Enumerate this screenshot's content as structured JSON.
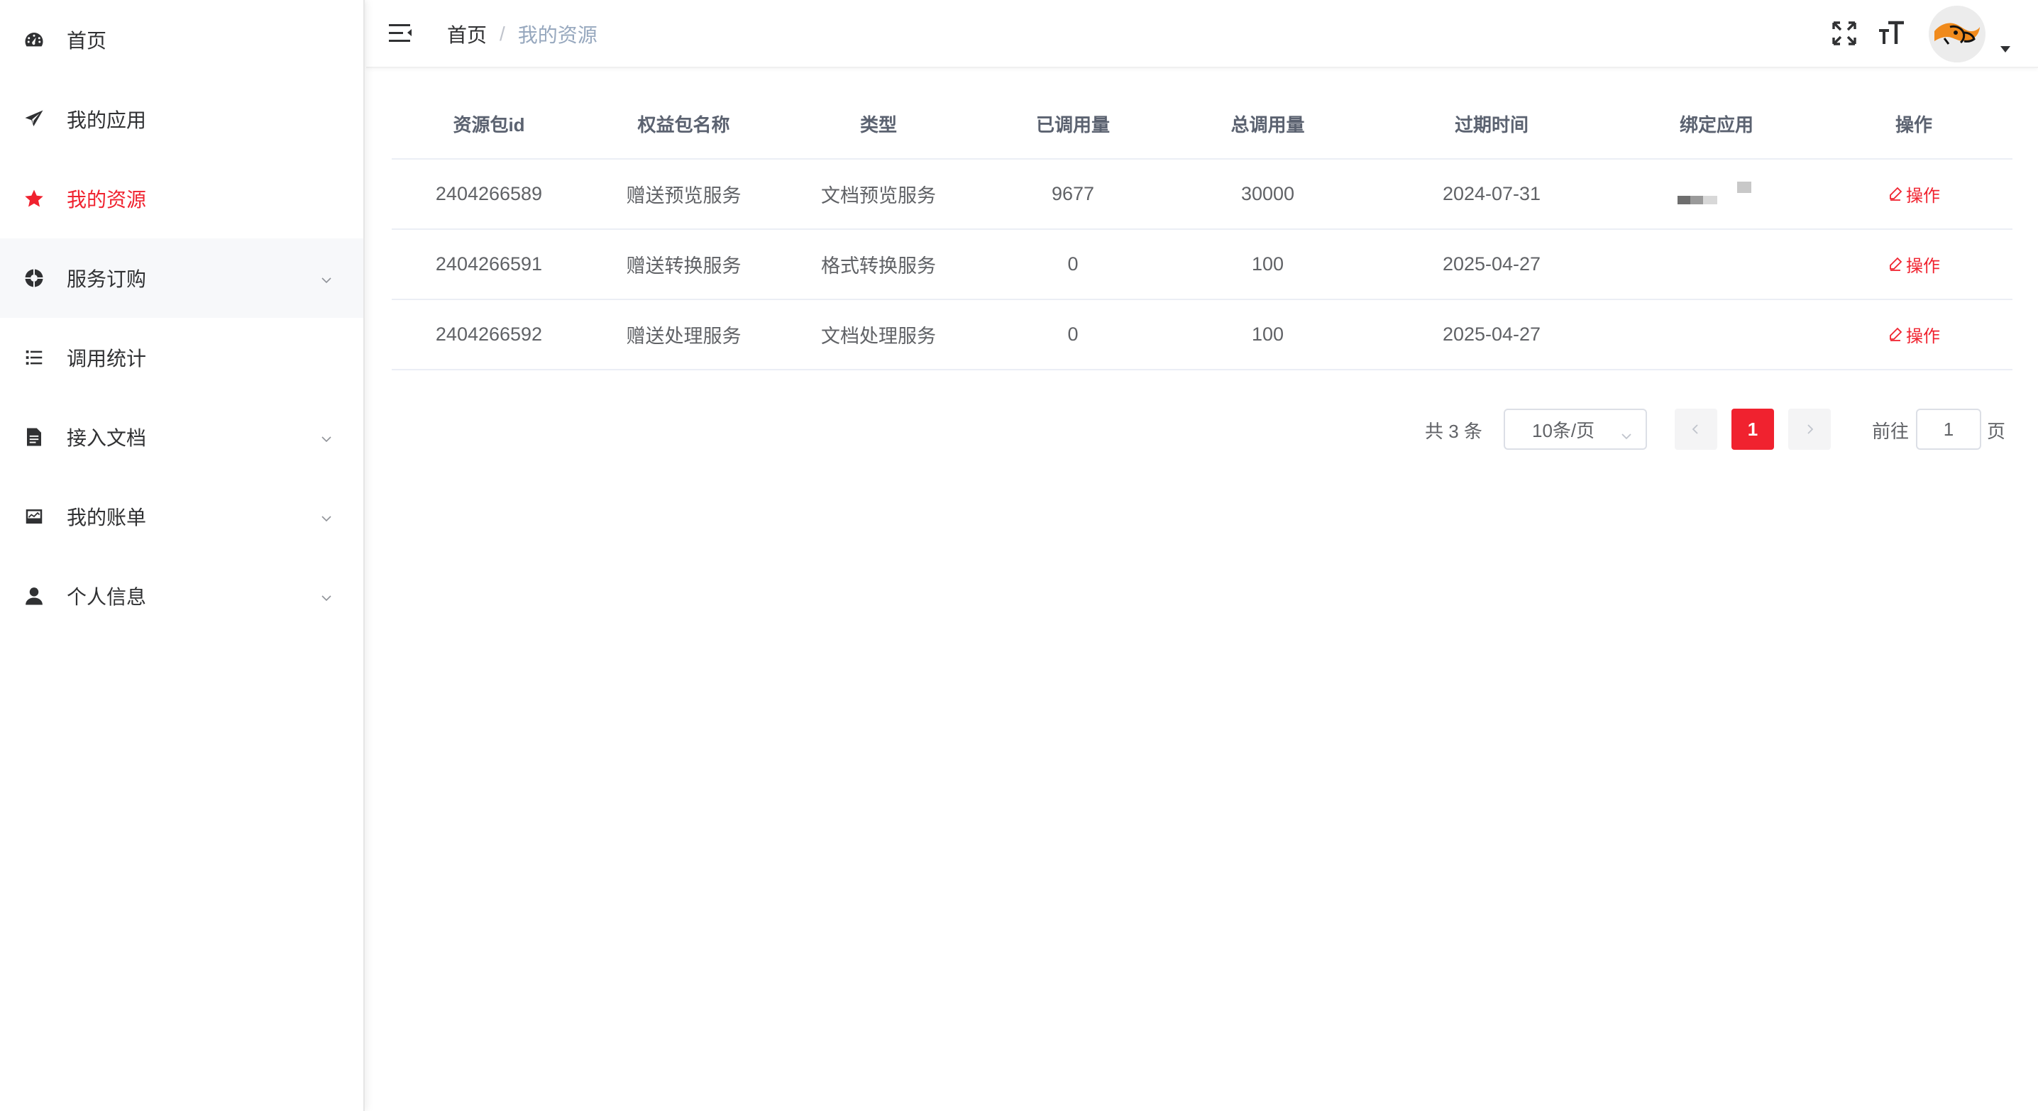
{
  "sidebar": {
    "items": [
      {
        "label": "首页",
        "icon": "dashboard-icon"
      },
      {
        "label": "我的应用",
        "icon": "paper-plane-icon"
      },
      {
        "label": "我的资源",
        "icon": "star-icon",
        "active": true
      },
      {
        "label": "服务订购",
        "icon": "aperture-icon",
        "expandable": true
      },
      {
        "label": "调用统计",
        "icon": "list-icon"
      },
      {
        "label": "接入文档",
        "icon": "document-icon",
        "expandable": true
      },
      {
        "label": "我的账单",
        "icon": "bill-icon",
        "expandable": true
      },
      {
        "label": "个人信息",
        "icon": "user-icon",
        "expandable": true
      }
    ]
  },
  "header": {
    "breadcrumb_home": "首页",
    "breadcrumb_separator": "/",
    "breadcrumb_current": "我的资源",
    "icons": [
      "hamburger-icon",
      "fullscreen-icon",
      "font-size-icon",
      "avatar",
      "caret-down-icon"
    ]
  },
  "table": {
    "columns": [
      "资源包id",
      "权益包名称",
      "类型",
      "已调用量",
      "总调用量",
      "过期时间",
      "绑定应用",
      "操作"
    ],
    "rows": [
      {
        "id": "2404266589",
        "name": "赠送预览服务",
        "type": "文档预览服务",
        "used": "9677",
        "total": "30000",
        "expire": "2024-07-31",
        "app": "",
        "action": "操作"
      },
      {
        "id": "2404266591",
        "name": "赠送转换服务",
        "type": "格式转换服务",
        "used": "0",
        "total": "100",
        "expire": "2025-04-27",
        "app": "",
        "action": "操作"
      },
      {
        "id": "2404266592",
        "name": "赠送处理服务",
        "type": "文档处理服务",
        "used": "0",
        "total": "100",
        "expire": "2025-04-27",
        "app": "",
        "action": "操作"
      }
    ]
  },
  "pagination": {
    "total_label": "共 3 条",
    "page_size": "10条/页",
    "current_page": "1",
    "goto_label": "前往",
    "goto_value": "1",
    "goto_suffix": "页"
  },
  "colors": {
    "accent": "#f0222f",
    "text": "#303133",
    "muted": "#97a8be"
  }
}
